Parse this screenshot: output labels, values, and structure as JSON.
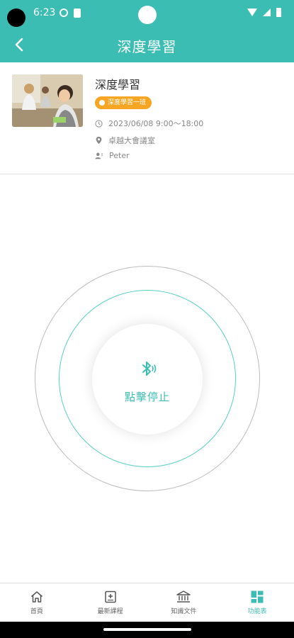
{
  "status_bar": {
    "time": "6:23",
    "icons": [
      "wifi-icon",
      "signal-icon",
      "battery-icon"
    ]
  },
  "app_bar": {
    "title": "深度學習",
    "back_icon": "chevron-left-icon"
  },
  "course": {
    "title": "深度學習",
    "badge": "深度學習一班",
    "datetime": "2023/06/08 9:00～18:00",
    "location": "卓越大會議室",
    "instructor": "Peter"
  },
  "bluetooth": {
    "icon": "bluetooth-icon",
    "action_label": "點擊停止"
  },
  "bottom_nav": {
    "items": [
      {
        "label": "首頁",
        "icon": "home-icon",
        "active": false
      },
      {
        "label": "最新課程",
        "icon": "new-course-icon",
        "active": false
      },
      {
        "label": "知識文件",
        "icon": "library-icon",
        "active": false
      },
      {
        "label": "功能表",
        "icon": "grid-menu-icon",
        "active": true
      }
    ]
  },
  "colors": {
    "accent": "#3bbdb3",
    "badge": "#f6a623",
    "ring_mid": "#5ccfc6",
    "ring_outer": "#bcbcbc"
  }
}
